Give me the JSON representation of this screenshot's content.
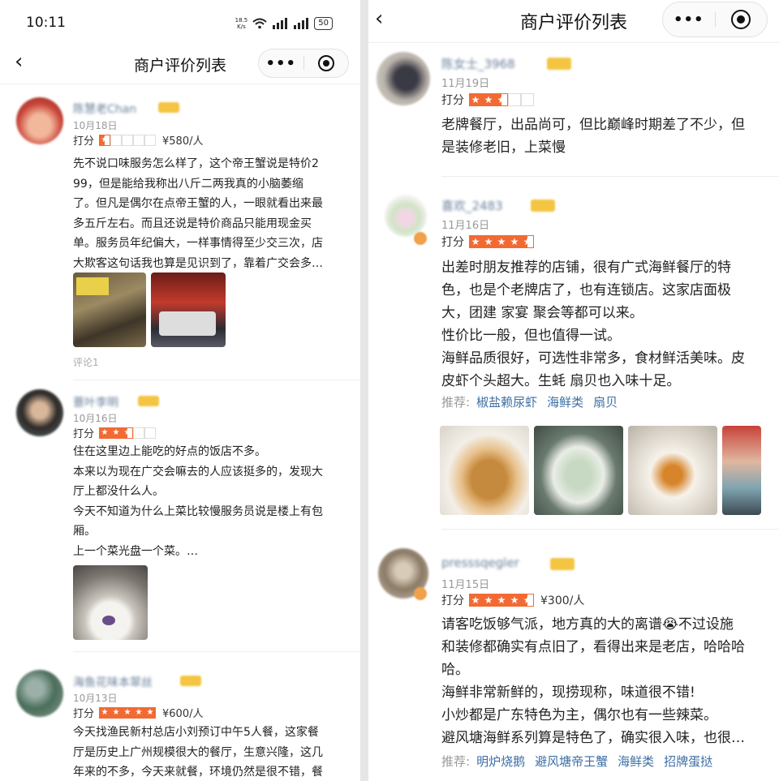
{
  "status": {
    "time": "10:11",
    "net_speed": "18.5",
    "net_unit": "K/s",
    "battery": "50"
  },
  "left_panel": {
    "title": "商户评价列表",
    "reviews": [
      {
        "user": "陈慧老Chan",
        "date": "10月18日",
        "score_label": "打分",
        "stars": 0.5,
        "price": "¥580/人",
        "text": [
          "先不说口味服务怎么样了，这个帝王蟹说是特价2",
          "99，但是能给我称出八斤二两我真的小脑萎缩",
          "了。但凡是偶尔在点帝王蟹的人，一眼就看出来最",
          "多五斤左右。而且还说是特价商品只能用现金买",
          "单。服务员年纪偏大，一样事情得至少交三次，店",
          "大欺客这句话我也算是见识到了，靠着广交会多…"
        ],
        "comment_count": "评论1"
      },
      {
        "user": "薏叶李明",
        "date": "10月16日",
        "score_label": "打分",
        "stars": 2.5,
        "text": [
          "住在这里边上能吃的好点的饭店不多。",
          "本来以为现在广交会嘛去的人应该挺多的，发现大",
          "厅上都没什么人。",
          "今天不知道为什么上菜比较慢服务员说是楼上有包",
          "厢。",
          "上一个菜光盘一个菜。…"
        ]
      },
      {
        "user": "海鱼花味本翠丝",
        "date": "10月13日",
        "score_label": "打分",
        "stars": 5,
        "price": "¥600/人",
        "text": [
          "今天找渔民新村总店小刘预订中午5人餐，这家餐",
          "厅是历史上广州规模很大的餐厅，生意兴隆，这几",
          "年来的不多，今天来就餐，环境仍然是很不错，餐"
        ]
      }
    ]
  },
  "right_panel": {
    "title": "商户评价列表",
    "reviews": [
      {
        "user": "陈女士_3968",
        "date": "11月19日",
        "score_label": "打分",
        "stars": 2.5,
        "text": [
          "老牌餐厅，出品尚可，但比巅峰时期差了不少，但",
          "是装修老旧，上菜慢"
        ]
      },
      {
        "user": "喜欢_2483",
        "date": "11月16日",
        "score_label": "打分",
        "stars": 4.5,
        "text": [
          "出差时朋友推荐的店铺，很有广式海鲜餐厅的特",
          "色，也是个老牌店了，也有连锁店。这家店面极",
          "大，团建 家宴 聚会等都可以来。",
          "性价比一般，但也值得一试。",
          "海鲜品质很好，可选性非常多，食材鲜活美味。皮",
          "皮虾个头超大。生蚝 扇贝也入味十足。"
        ],
        "tags_label": "推荐:",
        "tags": [
          "椒盐赖尿虾",
          "海鲜类",
          "扇贝"
        ]
      },
      {
        "user": "presssqegler",
        "date": "11月15日",
        "score_label": "打分",
        "stars": 4.5,
        "price": "¥300/人",
        "text": [
          "请客吃饭够气派，地方真的大的离谱😭不过设施",
          "和装修都确实有点旧了，看得出来是老店，哈哈哈",
          "哈。",
          "海鲜非常新鲜的，现捞现称，味道很不错!",
          "小炒都是广东特色为主，偶尔也有一些辣菜。",
          "避风塘海鲜系列算是特色了，确实很入味，也很…"
        ],
        "tags_label": "推荐:",
        "tags": [
          "明炉烧鹅",
          "避风塘帝王蟹",
          "海鲜类",
          "招牌蛋挞"
        ]
      }
    ]
  },
  "colors": {
    "star_on": "#f26a33",
    "tag": "#3c6fa3",
    "username": "#6a7f9a",
    "vip_badge": "#f4c542"
  },
  "icons": [
    "back-icon",
    "more-icon",
    "close-mini-program-icon",
    "wifi-icon",
    "signal-icon",
    "battery-icon",
    "vip-badge-icon",
    "star-icon"
  ]
}
